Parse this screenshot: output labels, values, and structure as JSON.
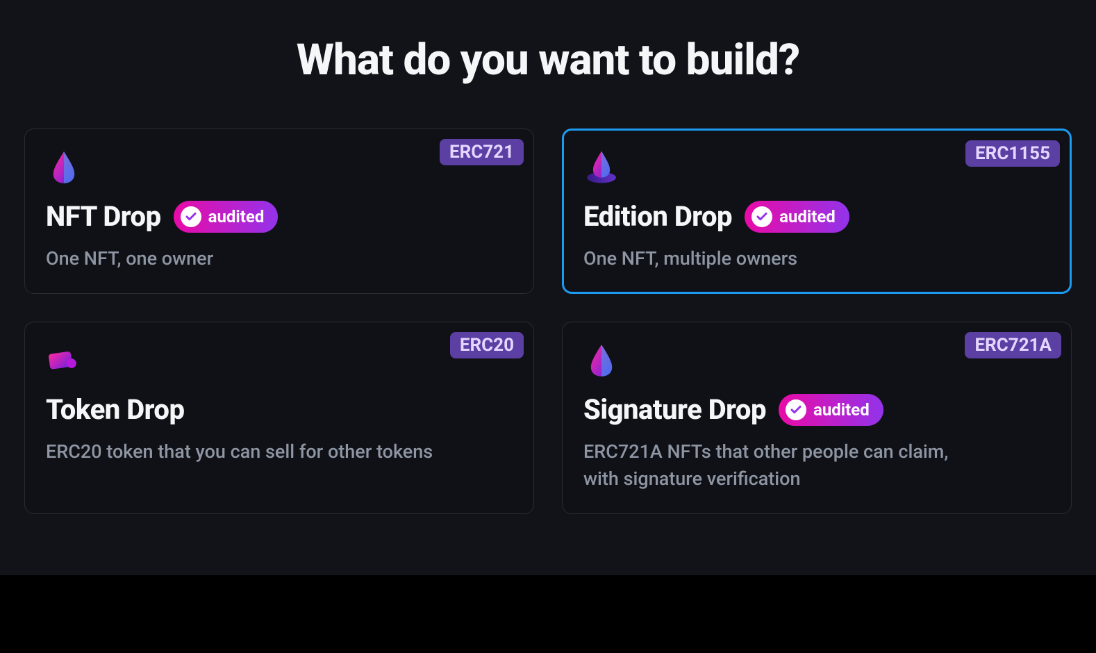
{
  "title": "What do you want to build?",
  "audited_label": "audited",
  "cards": [
    {
      "id": "nft-drop",
      "title": "NFT Drop",
      "badge": "ERC721",
      "description": "One NFT, one owner",
      "audited": true,
      "selected": false,
      "icon": "drop"
    },
    {
      "id": "edition-drop",
      "title": "Edition Drop",
      "badge": "ERC1155",
      "description": "One NFT, multiple owners",
      "audited": true,
      "selected": true,
      "icon": "drop-disc"
    },
    {
      "id": "token-drop",
      "title": "Token Drop",
      "badge": "ERC20",
      "description": "ERC20 token that you can sell for other tokens",
      "audited": false,
      "selected": false,
      "icon": "card"
    },
    {
      "id": "signature-drop",
      "title": "Signature Drop",
      "badge": "ERC721A",
      "description": "ERC721A NFTs that other people can claim, with signature verification",
      "audited": true,
      "selected": false,
      "icon": "drop"
    }
  ]
}
